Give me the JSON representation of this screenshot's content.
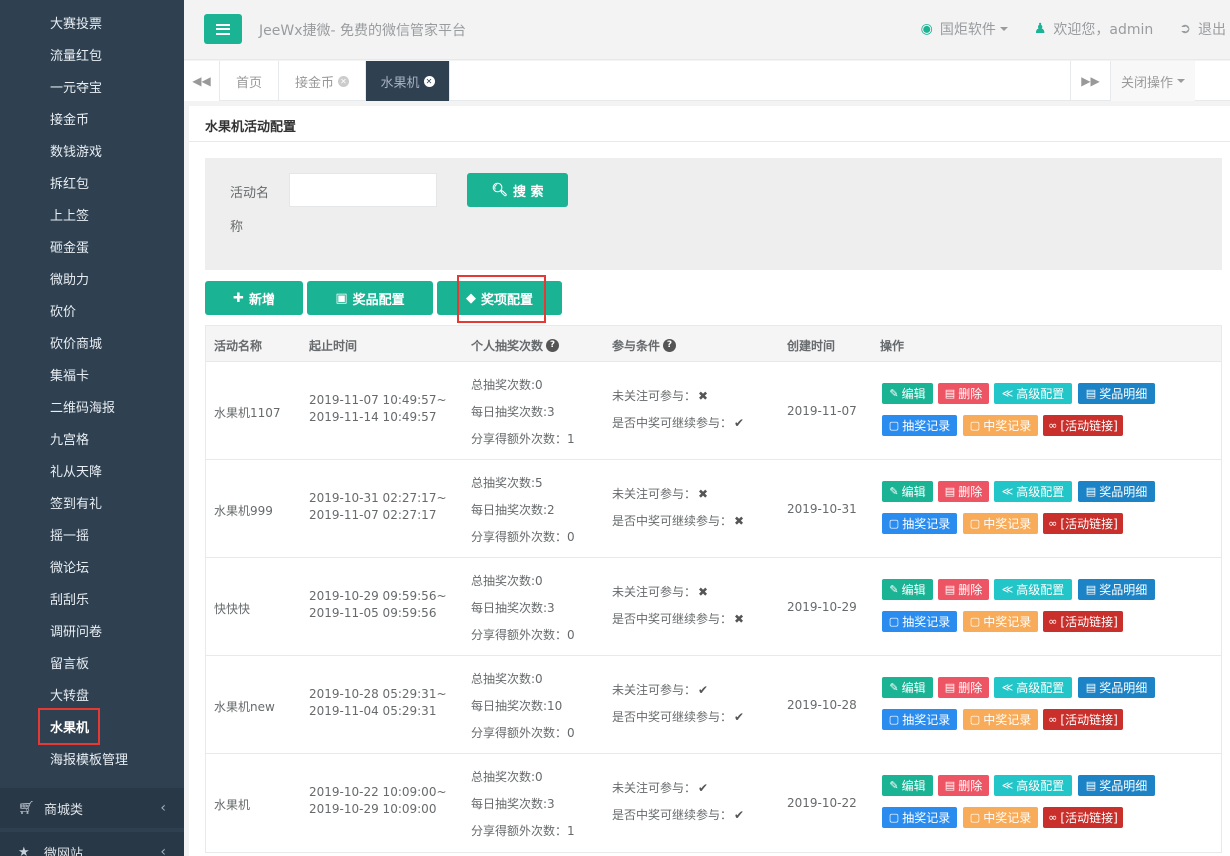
{
  "sidebar": {
    "items": [
      {
        "label": "大赛投票"
      },
      {
        "label": "流量红包"
      },
      {
        "label": "一元夺宝"
      },
      {
        "label": "接金币"
      },
      {
        "label": "数钱游戏"
      },
      {
        "label": "拆红包"
      },
      {
        "label": "上上签"
      },
      {
        "label": "砸金蛋"
      },
      {
        "label": "微助力"
      },
      {
        "label": "砍价"
      },
      {
        "label": "砍价商城"
      },
      {
        "label": "集福卡"
      },
      {
        "label": "二维码海报"
      },
      {
        "label": "九宫格"
      },
      {
        "label": "礼从天降"
      },
      {
        "label": "签到有礼"
      },
      {
        "label": "摇一摇"
      },
      {
        "label": "微论坛"
      },
      {
        "label": "刮刮乐"
      },
      {
        "label": "调研问卷"
      },
      {
        "label": "留言板"
      },
      {
        "label": "大转盘"
      },
      {
        "label": "水果机",
        "active": true
      },
      {
        "label": "海报模板管理"
      }
    ],
    "groups": [
      {
        "label": "商城类",
        "icon": "cart-icon"
      },
      {
        "label": "微网站",
        "icon": "star-icon"
      }
    ]
  },
  "header": {
    "brand": "JeeWx捷微- 免费的微信管家平台",
    "company": "国炬软件",
    "welcome": "欢迎您，admin",
    "logout": "退出"
  },
  "tabs": {
    "items": [
      {
        "label": "首页"
      },
      {
        "label": "接金币"
      },
      {
        "label": "水果机",
        "active": true
      }
    ],
    "close_ops": "关闭操作"
  },
  "panel": {
    "title": "水果机活动配置",
    "search": {
      "label_line1": "活动名",
      "label_line2": "称",
      "value": "",
      "button": "搜 索"
    },
    "actions": {
      "add": "新增",
      "prize_config": "奖品配置",
      "award_config": "奖项配置"
    }
  },
  "table": {
    "headers": {
      "name": "活动名称",
      "period": "起止时间",
      "draws": "个人抽奖次数",
      "conditions": "参与条件",
      "created": "创建时间",
      "ops": "操作"
    },
    "labels": {
      "total": "总抽奖次数:",
      "daily": "每日抽奖次数:",
      "share": "分享得额外次数：",
      "unfollow": "未关注可参与：",
      "continue": "是否中奖可继续参与："
    },
    "op_labels": {
      "edit": "编辑",
      "delete": "删除",
      "advanced": "高级配置",
      "prize_detail": "奖品明细",
      "draw_record": "抽奖记录",
      "win_record": "中奖记录",
      "link": "[活动链接]"
    },
    "rows": [
      {
        "name": "水果机1107",
        "start": "2019-11-07 10:49:57~",
        "end": "2019-11-14 10:49:57",
        "total": "0",
        "daily": "3",
        "share": "1",
        "unfollow": "✖",
        "cont": "✔",
        "created": "2019-11-07"
      },
      {
        "name": "水果机999",
        "start": "2019-10-31 02:27:17~",
        "end": "2019-11-07 02:27:17",
        "total": "5",
        "daily": "2",
        "share": "0",
        "unfollow": "✖",
        "cont": "✖",
        "created": "2019-10-31"
      },
      {
        "name": "快快快",
        "start": "2019-10-29 09:59:56~",
        "end": "2019-11-05 09:59:56",
        "total": "0",
        "daily": "3",
        "share": "0",
        "unfollow": "✖",
        "cont": "✖",
        "created": "2019-10-29"
      },
      {
        "name": "水果机new",
        "start": "2019-10-28 05:29:31~",
        "end": "2019-11-04 05:29:31",
        "total": "0",
        "daily": "10",
        "share": "0",
        "unfollow": "✔",
        "cont": "✔",
        "created": "2019-10-28"
      },
      {
        "name": "水果机",
        "start": "2019-10-22 10:09:00~",
        "end": "2019-10-29 10:09:00",
        "total": "0",
        "daily": "3",
        "share": "1",
        "unfollow": "✔",
        "cont": "✔",
        "created": "2019-10-22"
      }
    ]
  }
}
